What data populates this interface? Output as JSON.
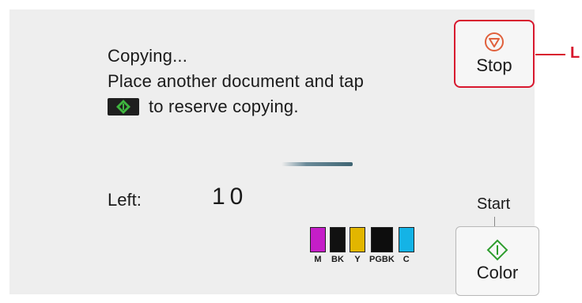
{
  "message": {
    "line1": "Copying...",
    "line2": "Place another document and tap",
    "line3": "to reserve copying.",
    "inline_icon": "start-diamond-icon"
  },
  "progress": {
    "style": "indeterminate"
  },
  "remaining": {
    "label": "Left:",
    "value": "10"
  },
  "inks": [
    {
      "label": "M",
      "color": "#c51ec8"
    },
    {
      "label": "BK",
      "color": "#111111"
    },
    {
      "label": "Y",
      "color": "#e2b600"
    },
    {
      "label": "PGBK",
      "color": "#0d0d0d"
    },
    {
      "label": "C",
      "color": "#14b3e6"
    }
  ],
  "stop_button": {
    "label": "Stop",
    "icon": "stop-icon",
    "highlight_color": "#d8182e"
  },
  "callout": {
    "letter": "L"
  },
  "start": {
    "label": "Start",
    "button_label": "Color",
    "icon": "start-diamond-icon",
    "icon_color": "#2e9d2e"
  }
}
